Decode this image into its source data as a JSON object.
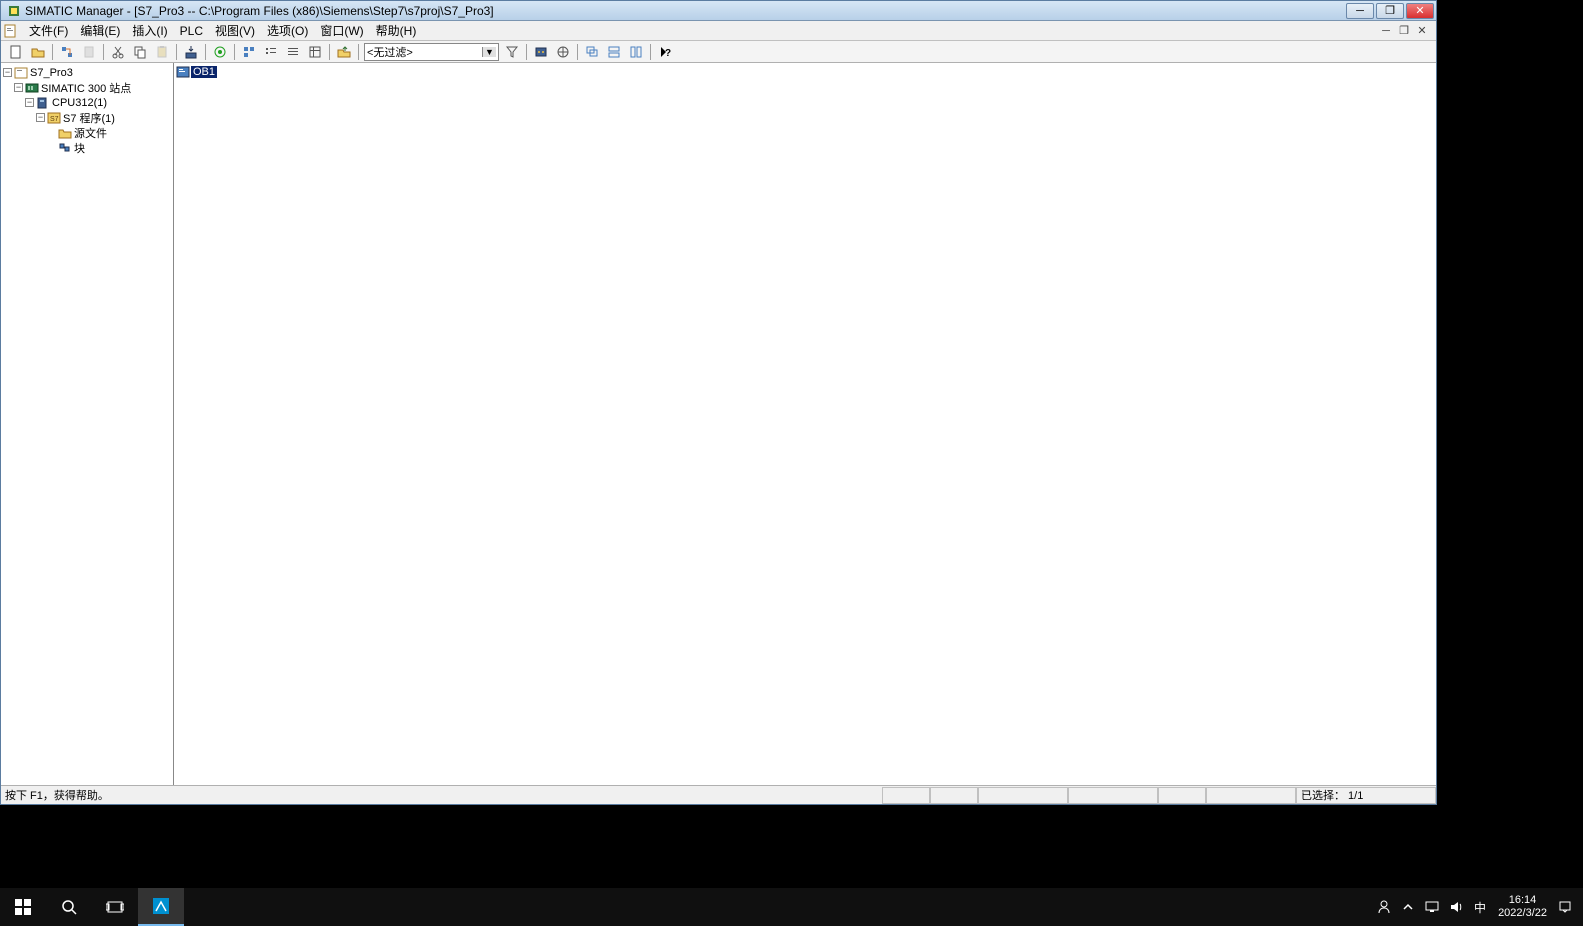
{
  "window": {
    "title": "SIMATIC Manager - [S7_Pro3 -- C:\\Program Files (x86)\\Siemens\\Step7\\s7proj\\S7_Pro3]"
  },
  "menu": {
    "items": [
      "文件(F)",
      "编辑(E)",
      "插入(I)",
      "PLC",
      "视图(V)",
      "选项(O)",
      "窗口(W)",
      "帮助(H)"
    ]
  },
  "toolbar": {
    "filter_text": "<无过滤>"
  },
  "tree": {
    "root": "S7_Pro3",
    "station": "SIMATIC 300 站点",
    "cpu": "CPU312(1)",
    "program": "S7 程序(1)",
    "sources": "源文件",
    "blocks": "块"
  },
  "content": {
    "selected_block": "OB1"
  },
  "statusbar": {
    "help": "按下 F1，获得帮助。",
    "selection": "已选择：  1/1"
  },
  "taskbar": {
    "time": "16:14",
    "date": "2022/3/22",
    "ime": "中"
  }
}
